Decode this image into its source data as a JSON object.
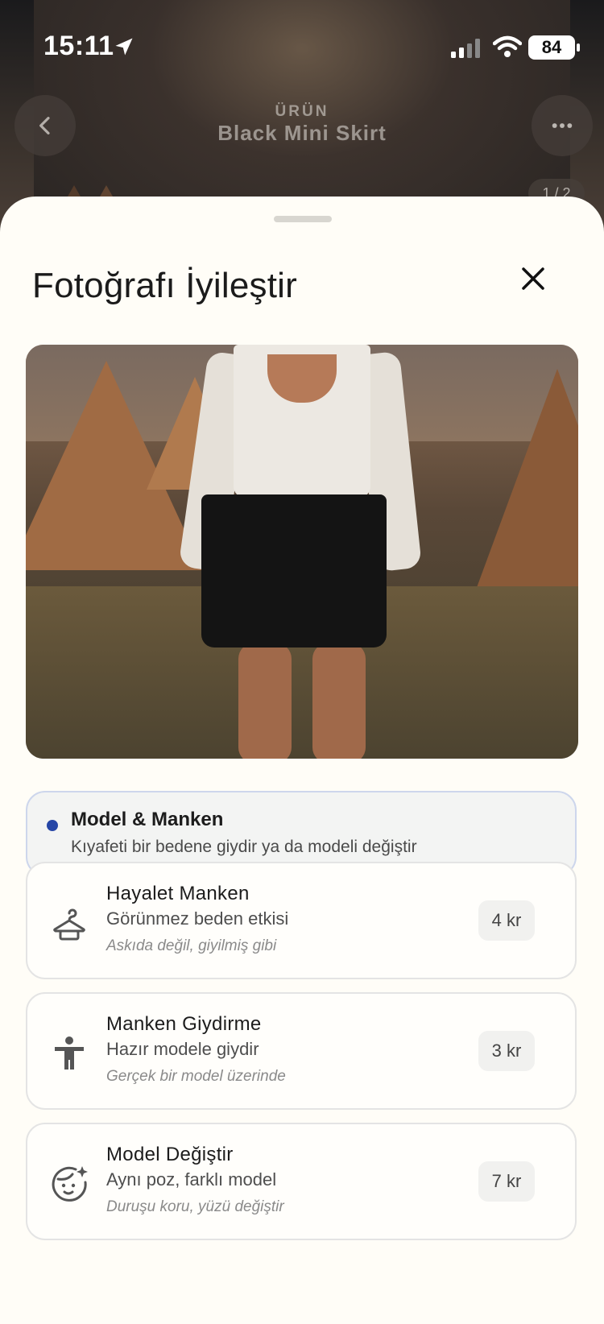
{
  "status_bar": {
    "time": "15:11",
    "battery": "84"
  },
  "background": {
    "section_label": "ÜRÜN",
    "product_name": "Black Mini Skirt",
    "image_counter": "1 / 2"
  },
  "sheet": {
    "title": "Fotoğrafı İyileştir",
    "selected_option": {
      "title": "Model & Manken",
      "subtitle": "Kıyafeti bir bedene giydir ya da modeli değiştir"
    },
    "options": [
      {
        "icon": "hanger-icon",
        "title": "Hayalet Manken",
        "subtitle": "Görünmez beden etkisi",
        "note": "Askıda değil, giyilmiş gibi",
        "price": "4 kr"
      },
      {
        "icon": "person-icon",
        "title": "Manken Giydirme",
        "subtitle": "Hazır modele giydir",
        "note": "Gerçek bir model üzerinde",
        "price": "3 kr"
      },
      {
        "icon": "face-sparkle-icon",
        "title": "Model Değiştir",
        "subtitle": "Aynı poz, farklı model",
        "note": "Duruşu koru, yüzü değiştir",
        "price": "7 kr"
      }
    ]
  },
  "colors": {
    "accent": "#2646a6",
    "sheet_bg": "#fffdf7",
    "selected_bg": "#f3f4f3",
    "selected_border": "#cdd6ec"
  }
}
